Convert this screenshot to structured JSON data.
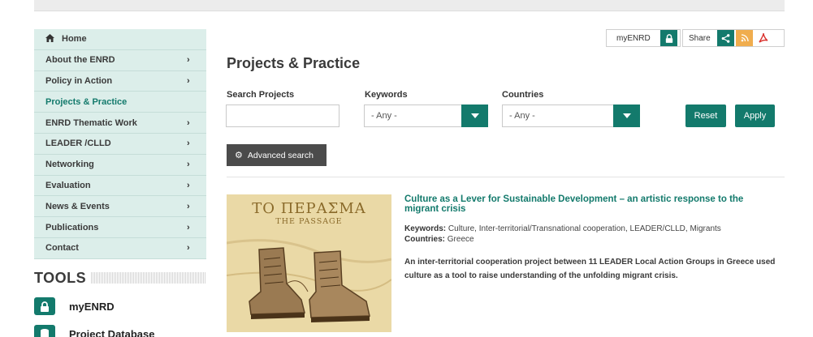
{
  "sidebar": {
    "items": [
      {
        "label": "Home",
        "icon": "home-icon",
        "has_chevron": false,
        "active": false
      },
      {
        "label": "About the ENRD",
        "has_chevron": true,
        "active": false
      },
      {
        "label": "Policy in Action",
        "has_chevron": true,
        "active": false
      },
      {
        "label": "Projects & Practice",
        "has_chevron": false,
        "active": true
      },
      {
        "label": "ENRD Thematic Work",
        "has_chevron": true,
        "active": false
      },
      {
        "label": "LEADER /CLLD",
        "has_chevron": true,
        "active": false
      },
      {
        "label": "Networking",
        "has_chevron": true,
        "active": false
      },
      {
        "label": "Evaluation",
        "has_chevron": true,
        "active": false
      },
      {
        "label": "News & Events",
        "has_chevron": true,
        "active": false
      },
      {
        "label": "Publications",
        "has_chevron": true,
        "active": false
      },
      {
        "label": "Contact",
        "has_chevron": true,
        "active": false
      }
    ],
    "chevron": "›"
  },
  "tools": {
    "title": "TOOLS",
    "items": [
      {
        "label": "myENRD",
        "icon": "lock-icon"
      },
      {
        "label": "Project Database",
        "icon": "database-icon"
      }
    ]
  },
  "utility": {
    "myenrd_label": "myENRD",
    "share_label": "Share"
  },
  "main": {
    "title": "Projects & Practice",
    "search_label": "Search Projects",
    "search_value": "",
    "keywords_label": "Keywords",
    "keywords_value": "- Any -",
    "countries_label": "Countries",
    "countries_value": "- Any -",
    "reset_label": "Reset",
    "apply_label": "Apply",
    "advanced_label": "Advanced search"
  },
  "result": {
    "image_title": "ΤΟ ΠΕΡΑΣΜΑ",
    "image_subtitle": "THE PASSAGE",
    "title": "Culture as a Lever for Sustainable Development – an artistic response to the migrant crisis",
    "keywords_label": "Keywords:",
    "keywords": "Culture, Inter-territorial/Transnational cooperation, LEADER/CLLD, Migrants",
    "countries_label": "Countries:",
    "countries": "Greece",
    "description": "An inter-territorial cooperation project between 11 LEADER Local Action Groups in Greece used culture as a tool to raise understanding of the unfolding migrant crisis."
  },
  "colors": {
    "accent": "#137a6c",
    "sidebar_bg": "#dceeea",
    "rss": "#f0ad4e",
    "pdf": "#d9302c"
  }
}
